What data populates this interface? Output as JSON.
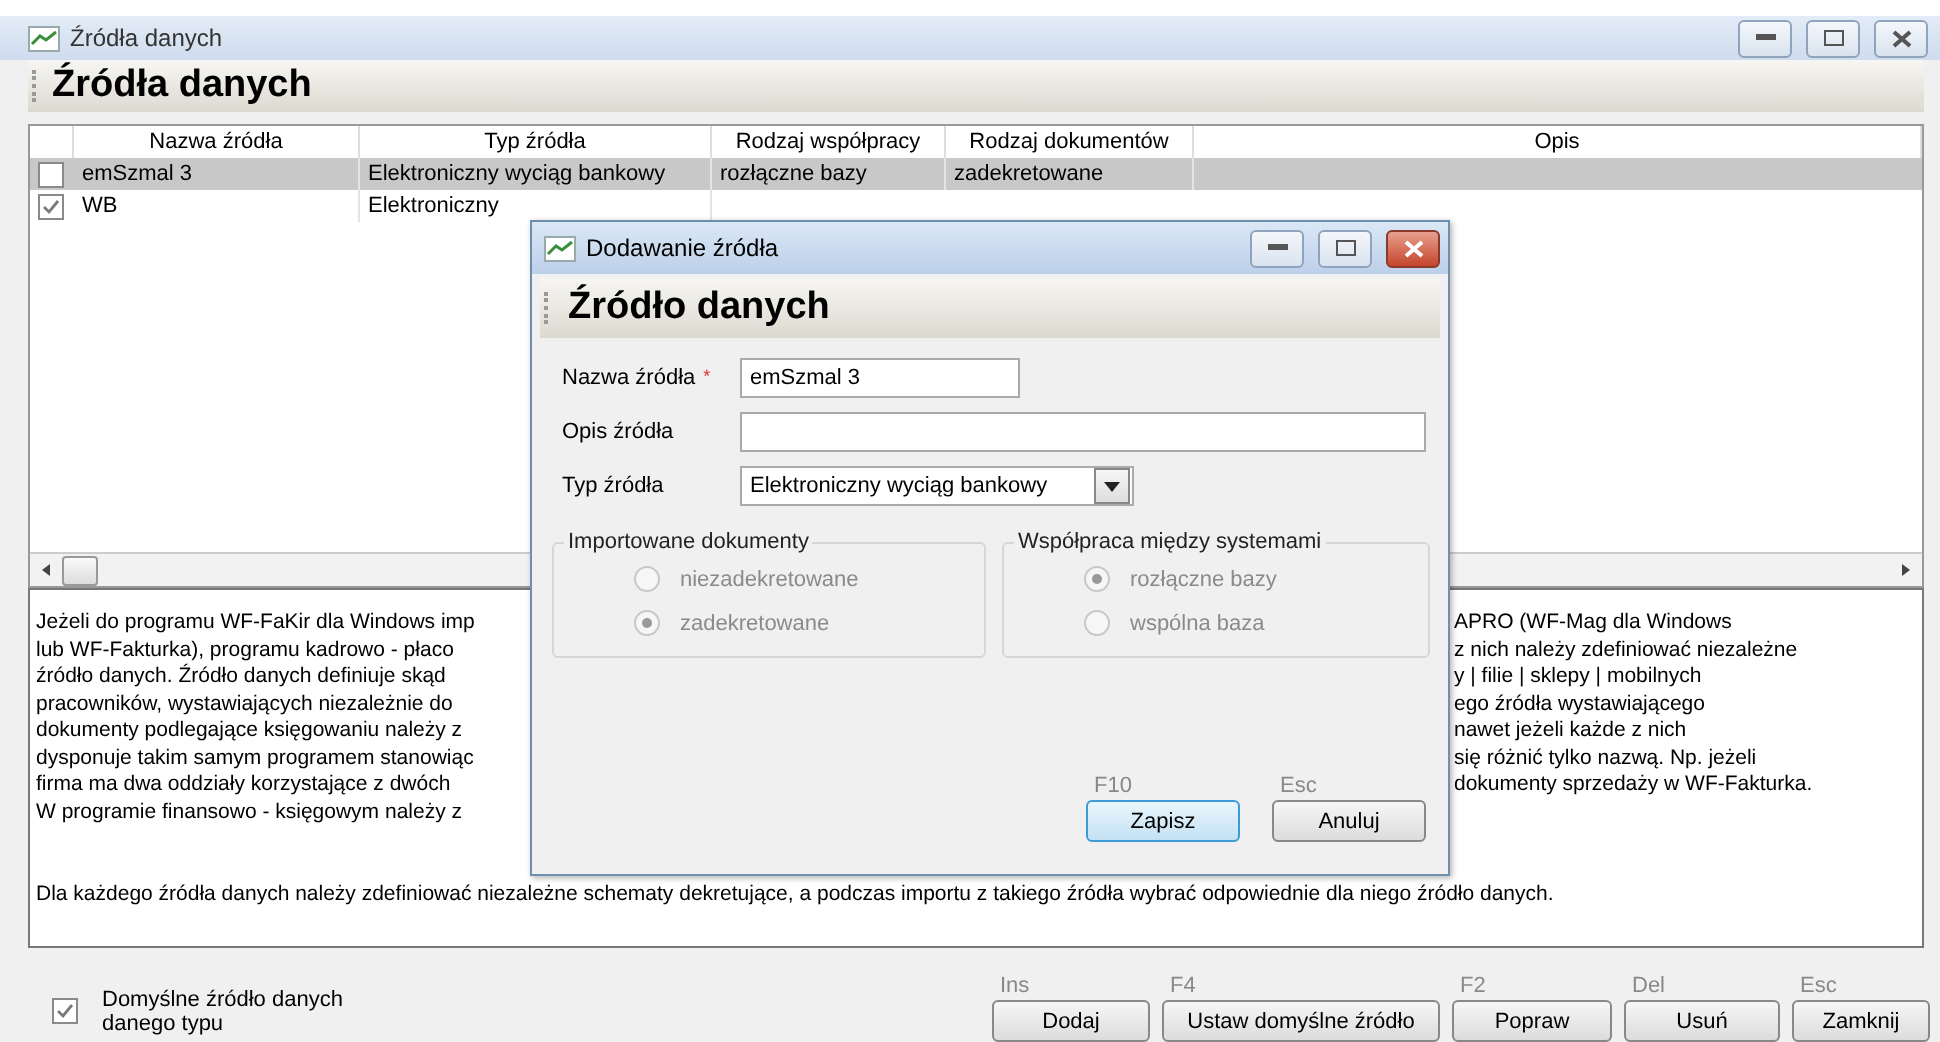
{
  "window": {
    "title": "Źródła danych"
  },
  "header": "Źródła danych",
  "table": {
    "columns": [
      "Nazwa źródła",
      "Typ źródła",
      "Rodzaj współpracy",
      "Rodzaj dokumentów",
      "Opis"
    ],
    "rows": [
      {
        "checked": false,
        "selected": true,
        "cells": [
          "emSzmal 3",
          "Elektroniczny wyciąg bankowy",
          "rozłączne bazy",
          "zadekretowane"
        ]
      },
      {
        "checked": true,
        "selected": false,
        "cells": [
          "WB",
          "Elektroniczny"
        ]
      }
    ]
  },
  "description": {
    "lines": [
      {
        "left": "Jeżeli do programu WF-FaKir dla Windows imp",
        "right": "APRO (WF-Mag dla Windows"
      },
      {
        "left": "lub WF-Fakturka), programu kadrowo - płaco",
        "right": "z nich należy zdefiniować niezależne"
      },
      {
        "left": "źródło danych. Źródło danych definiuje skąd",
        "right": "y | filie | sklepy | mobilnych"
      },
      {
        "left": "pracowników, wystawiających niezależnie do",
        "right": "ego źródła wystawiającego"
      },
      {
        "left": "dokumenty podlegające księgowaniu należy z",
        "right": "nawet jeżeli każde z nich"
      },
      {
        "left": "dysponuje takim samym programem stanowiąc",
        "right": "się różnić tylko nazwą. Np. jeżeli"
      },
      {
        "left": "firma ma dwa oddziały korzystające z dwóch",
        "right": "dokumenty sprzedaży w WF-Fakturka."
      },
      {
        "left": "W programie finansowo - księgowym należy z"
      }
    ],
    "footer": "Dla każdego źródła danych należy zdefiniować niezależne schematy dekretujące, a podczas importu z takiego źródła wybrać odpowiednie dla niego źródło danych."
  },
  "default_checkbox": {
    "label": "Domyślne źródło danych danego typu",
    "checked": true
  },
  "buttons": [
    {
      "shortcut": "Ins",
      "label": "Dodaj"
    },
    {
      "shortcut": "F4",
      "label": "Ustaw domyślne źródło"
    },
    {
      "shortcut": "F2",
      "label": "Popraw"
    },
    {
      "shortcut": "Del",
      "label": "Usuń"
    },
    {
      "shortcut": "Esc",
      "label": "Zamknij"
    }
  ],
  "dialog": {
    "title": "Dodawanie źródła",
    "header": "Źródło danych",
    "fields": [
      {
        "kind": "text",
        "label": "Nazwa źródła",
        "required_mark": "*",
        "value": "emSzmal 3"
      },
      {
        "kind": "wide",
        "label": "Opis źródła"
      },
      {
        "kind": "select",
        "label": "Typ źródła",
        "value": "Elektroniczny wyciąg bankowy"
      }
    ],
    "groups": [
      {
        "title": "Importowane dokumenty",
        "disabled": true,
        "options": [
          {
            "label": "niezadekretowane",
            "selected": false
          },
          {
            "label": "zadekretowane",
            "selected": true
          }
        ]
      },
      {
        "title": "Współpraca między systemami",
        "disabled": true,
        "options": [
          {
            "label": "rozłączne bazy",
            "selected": true
          },
          {
            "label": "wspólna baza",
            "selected": false
          }
        ]
      }
    ],
    "buttons": [
      {
        "shortcut": "F10",
        "label": "Zapisz",
        "focused": true
      },
      {
        "shortcut": "Esc",
        "label": "Anuluj",
        "focused": false
      }
    ]
  }
}
